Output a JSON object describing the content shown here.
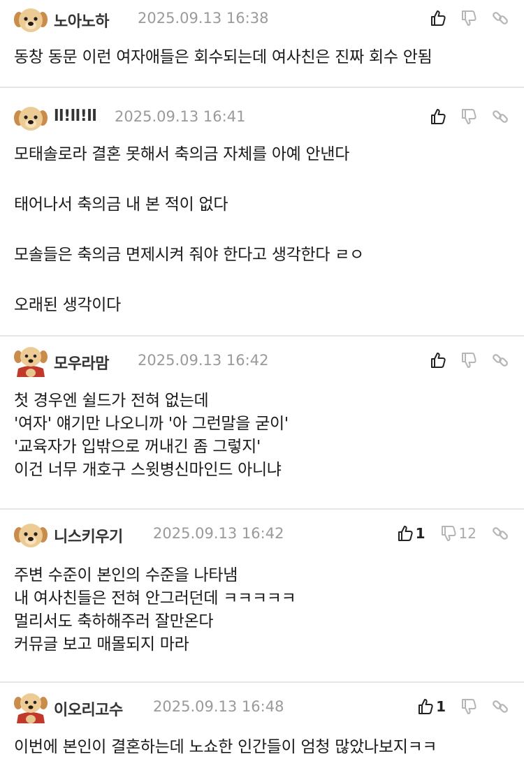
{
  "comments": [
    {
      "nickname": "노아노하",
      "date": "2025.09.13 16:38",
      "avatar": "puppy",
      "likes": "",
      "dislikes": "",
      "lines": [
        "동창 동문 이런 여자애들은 회수되는데 여사친은 진짜 회수 안됨"
      ]
    },
    {
      "nickname": "ll!ll!ll",
      "date": "2025.09.13 16:41",
      "avatar": "puppy",
      "likes": "",
      "dislikes": "",
      "lines": [
        "모태솔로라 결혼 못해서 축의금 자체를 아예 안낸다",
        "",
        "태어나서 축의금 내 본 적이 없다",
        "",
        "모솔들은 축의금 면제시켜 줘야 한다고 생각한다 ㄹㅇ",
        "",
        "오래된 생각이다"
      ]
    },
    {
      "nickname": "모우라맘",
      "date": "2025.09.13 16:42",
      "avatar": "puppy-cape",
      "likes": "",
      "dislikes": "",
      "lines": [
        "첫 경우엔 쉴드가 전혀 없는데",
        "'여자' 얘기만 나오니까 '아 그런말을 굳이'",
        "'교육자가 입밖으로 꺼내긴 좀 그렇지'",
        "이건 너무 개호구 스윗병신마인드 아니냐"
      ]
    },
    {
      "nickname": "니스키우기",
      "date": "2025.09.13 16:42",
      "avatar": "puppy",
      "likes": "1",
      "dislikes": "12",
      "lines": [
        "주변 수준이 본인의 수준을 나타냄",
        "내 여사친들은 전혀 안그러던데 ㅋㅋㅋㅋㅋ",
        "멀리서도 축하해주러 잘만온다",
        "커뮤글 보고 매몰되지 마라"
      ]
    },
    {
      "nickname": "이오리고수",
      "date": "2025.09.13 16:48",
      "avatar": "puppy-cape",
      "likes": "1",
      "dislikes": "",
      "lines": [
        "이번에 본인이 결혼하는데 노쇼한 인간들이 엄청 많았나보지ㅋㅋ"
      ]
    }
  ],
  "icons": {
    "like": "thumbs-up-icon",
    "dislike": "thumbs-down-icon",
    "share": "link-icon"
  },
  "colors": {
    "divider": "#e6e6e6",
    "date": "#9a9a9a",
    "text": "#1a1a1a",
    "muted_icon": "#b5b5b5",
    "active_icon": "#222222"
  }
}
